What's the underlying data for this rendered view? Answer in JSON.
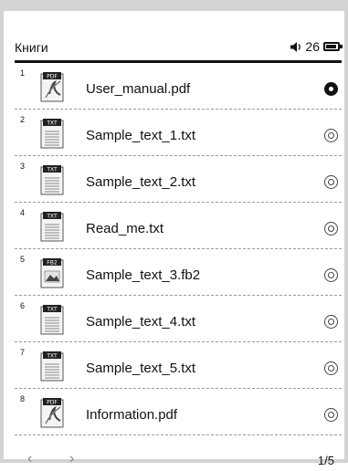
{
  "header": {
    "title": "Книги",
    "battery_level": "26",
    "volume_icon": "speaker-icon",
    "battery_icon": "battery-icon"
  },
  "files": [
    {
      "num": "1",
      "name": "User_manual.pdf",
      "type": "PDF",
      "selected": true
    },
    {
      "num": "2",
      "name": "Sample_text_1.txt",
      "type": "TXT",
      "selected": false
    },
    {
      "num": "3",
      "name": "Sample_text_2.txt",
      "type": "TXT",
      "selected": false
    },
    {
      "num": "4",
      "name": "Read_me.txt",
      "type": "TXT",
      "selected": false
    },
    {
      "num": "5",
      "name": "Sample_text_3.fb2",
      "type": "FB2",
      "selected": false
    },
    {
      "num": "6",
      "name": "Sample_text_4.txt",
      "type": "TXT",
      "selected": false
    },
    {
      "num": "7",
      "name": "Sample_text_5.txt",
      "type": "TXT",
      "selected": false
    },
    {
      "num": "8",
      "name": "Information.pdf",
      "type": "PDF",
      "selected": false
    }
  ],
  "footer": {
    "prev_icon": "chevron-left-icon",
    "next_icon": "chevron-right-icon",
    "page": "1/5"
  }
}
